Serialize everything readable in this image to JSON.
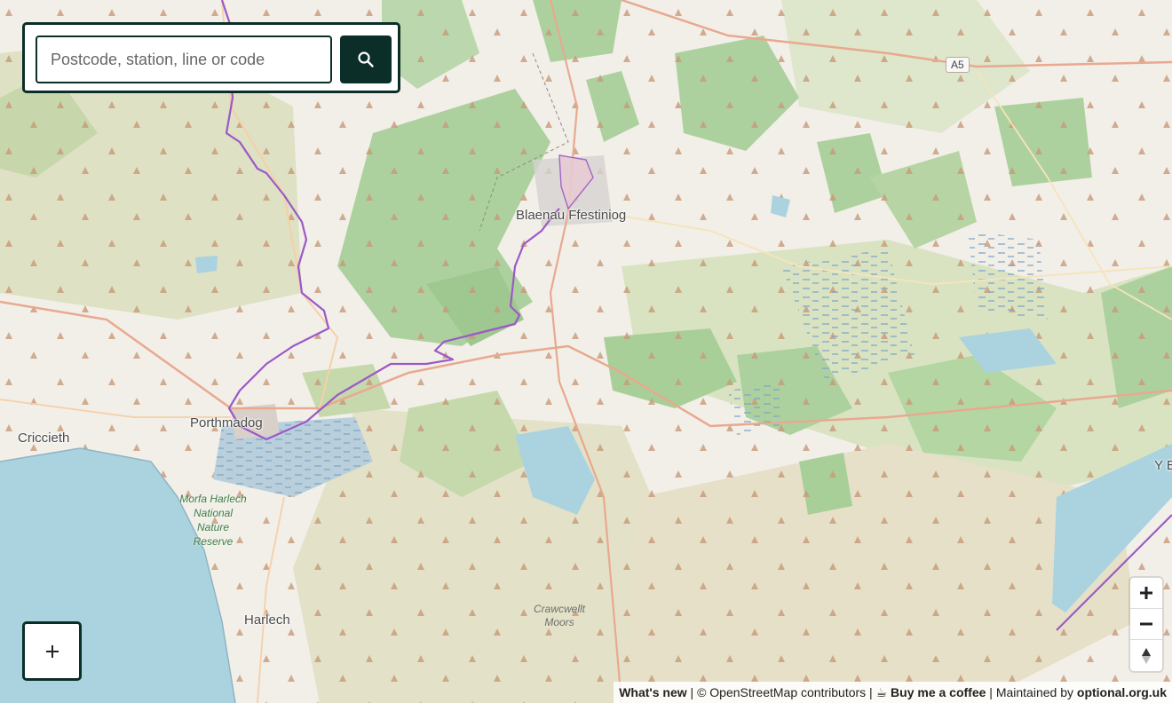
{
  "search": {
    "placeholder": "Postcode, station, line or code",
    "button_icon": "search-icon"
  },
  "places": {
    "blaenau": "Blaenau Ffestiniog",
    "porthmadog": "Porthmadog",
    "criccieth": "Criccieth",
    "harlech": "Harlech",
    "edge": "Y B"
  },
  "nature_reserve": {
    "line1": "Morfa Harlech",
    "line2": "National",
    "line3": "Nature",
    "line4": "Reserve"
  },
  "moors": {
    "line1": "Crawcwellt",
    "line2": "Moors"
  },
  "road_shield": "A5",
  "zoom": {
    "in_icon": "plus-icon",
    "out_icon": "minus-icon",
    "compass_icon": "compass-icon"
  },
  "add_button_icon": "plus-icon",
  "attribution": {
    "whats_new": "What's new",
    "sep1": " | © ",
    "osm": "OpenStreetMap",
    "contributors": " contributors | ",
    "coffee_icon": "☕",
    "coffee": "Buy me a coffee",
    "sep2": " | Maintained by ",
    "maintainer": "optional.org.uk"
  },
  "colors": {
    "accent": "#0b2e28",
    "route": "#9b59c6",
    "water": "#aad3df",
    "woodland": "#add19e",
    "land": "#f2efe9"
  }
}
